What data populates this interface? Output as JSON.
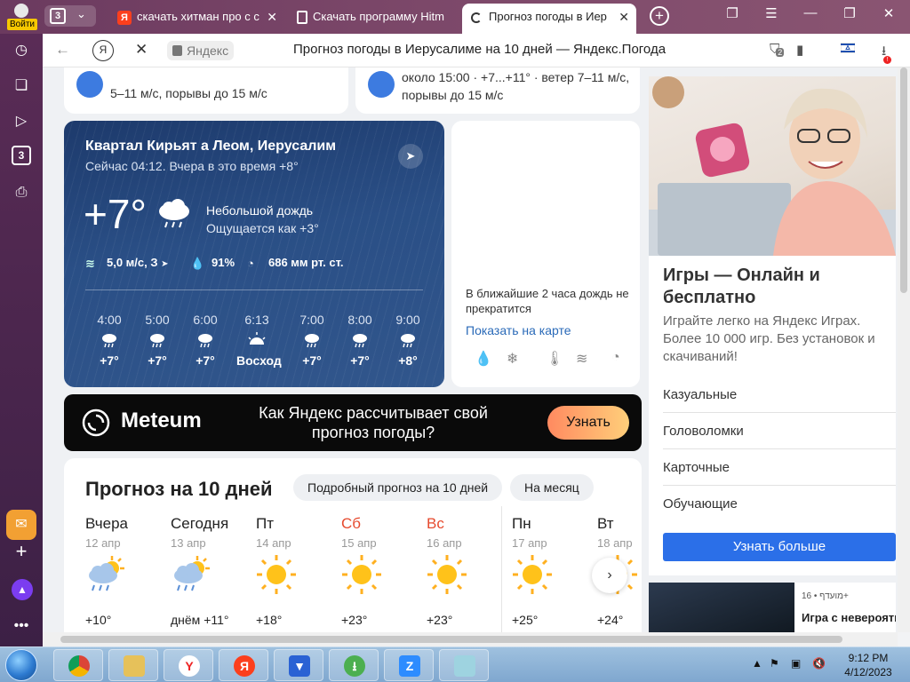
{
  "browser": {
    "profile_label": "Войти",
    "tab_count": "3",
    "tabs": [
      {
        "title": "скачать хитман про с с"
      },
      {
        "title": "Скачать программу Hitm"
      },
      {
        "title": "Прогноз погоды в Иер"
      }
    ],
    "yandex_letter": "Я",
    "domain": "Яндекс",
    "page_title": "Прогноз погоды в Иерусалиме на 10 дней — Яндекс.Погода",
    "downloads_badge": "2"
  },
  "top_cards": {
    "left_text": "5–11 м/с, порывы до 15 м/с",
    "right_line1": "около 15:00 · +7...+11° · ветер 7–11 м/с,",
    "right_line2": "порывы до 15 м/с"
  },
  "current": {
    "location": "Квартал Кирьят а Леом, Иерусалим",
    "now": "Сейчас 04:12. Вчера в это время +8°",
    "temp": "+7°",
    "condition": "Небольшой дождь",
    "feels_like": "Ощущается как +3°",
    "wind": "5,0 м/с, З",
    "humidity": "91%",
    "pressure": "686 мм рт. ст.",
    "hours": [
      {
        "time": "4:00",
        "value": "+7°",
        "icon": "rain-cloud-icon"
      },
      {
        "time": "5:00",
        "value": "+7°",
        "icon": "rain-cloud-icon"
      },
      {
        "time": "6:00",
        "value": "+7°",
        "icon": "rain-cloud-icon"
      },
      {
        "time": "6:13",
        "value": "Восход",
        "icon": "sunrise-icon"
      },
      {
        "time": "7:00",
        "value": "+7°",
        "icon": "rain-cloud-icon"
      },
      {
        "time": "8:00",
        "value": "+7°",
        "icon": "rain-cloud-icon"
      },
      {
        "time": "9:00",
        "value": "+8°",
        "icon": "rain-cloud-icon"
      }
    ]
  },
  "precip": {
    "text": "В ближайшие 2 часа дождь не прекратится",
    "link": "Показать на карте"
  },
  "meteum": {
    "logo": "Meteum",
    "text": "Как Яндекс рассчитывает свой прогноз погоды?",
    "button": "Узнать"
  },
  "forecast": {
    "title": "Прогноз на 10 дней",
    "detailed_btn": "Подробный прогноз на 10 дней",
    "month_btn": "На месяц",
    "days": [
      {
        "name": "Вчера",
        "date": "12 апр",
        "temp": "+10°",
        "icon": "sun-rain-cloud-icon",
        "weekend": false
      },
      {
        "name": "Сегодня",
        "date": "13 апр",
        "temp": "днём +11°",
        "icon": "sun-rain-cloud-icon",
        "weekend": false
      },
      {
        "name": "Пт",
        "date": "14 апр",
        "temp": "+18°",
        "icon": "sun-icon",
        "weekend": false
      },
      {
        "name": "Сб",
        "date": "15 апр",
        "temp": "+23°",
        "icon": "sun-icon",
        "weekend": true
      },
      {
        "name": "Вс",
        "date": "16 апр",
        "temp": "+23°",
        "icon": "sun-icon",
        "weekend": true
      },
      {
        "name": "Пн",
        "date": "17 апр",
        "temp": "+25°",
        "icon": "sun-icon",
        "weekend": false
      },
      {
        "name": "Вт",
        "date": "18 апр",
        "temp": "+24°",
        "icon": "sun-icon",
        "weekend": false
      }
    ]
  },
  "ad": {
    "title": "Игры — Онлайн и бесплатно",
    "subtitle": "Играйте легко на Яндекс Играх. Более 10 000 игр. Без установок и скачиваний!",
    "categories": [
      "Казуальные",
      "Головоломки",
      "Карточные",
      "Обучающие"
    ],
    "button": "Узнать больше"
  },
  "ad2": {
    "tag": "מועדף • 16+",
    "title": "Игра с невероятн"
  },
  "taskbar": {
    "time": "9:12 PM",
    "date": "4/12/2023"
  },
  "colors": {
    "accent_blue": "#2b6fe8",
    "weekend_red": "#e64a2e",
    "link_blue": "#2a6ab8"
  }
}
